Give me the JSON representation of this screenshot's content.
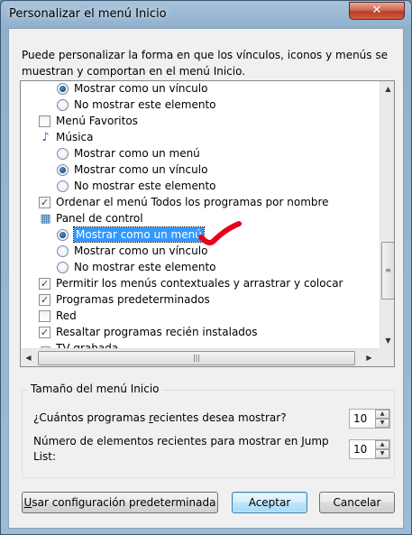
{
  "window": {
    "title": "Personalizar el menú Inicio",
    "close_label": "✕"
  },
  "intro_text": "Puede personalizar la forma en que los vínculos, iconos y menús se muestran y comportan en el menú Inicio.",
  "list_items": [
    {
      "kind": "radio",
      "checked": true,
      "label": "Mostrar como un vínculo"
    },
    {
      "kind": "radio",
      "checked": false,
      "label": "No mostrar este elemento"
    },
    {
      "kind": "check",
      "checked": false,
      "label": "Menú Favoritos"
    },
    {
      "kind": "header",
      "icon": "music-note-icon",
      "label": "Música"
    },
    {
      "kind": "radio",
      "checked": false,
      "label": "Mostrar como un menú"
    },
    {
      "kind": "radio",
      "checked": true,
      "label": "Mostrar como un vínculo"
    },
    {
      "kind": "radio",
      "checked": false,
      "label": "No mostrar este elemento"
    },
    {
      "kind": "check",
      "checked": true,
      "label": "Ordenar el menú Todos los programas por nombre"
    },
    {
      "kind": "header",
      "icon": "control-panel-icon",
      "label": "Panel de control"
    },
    {
      "kind": "radio",
      "checked": true,
      "label": "Mostrar como un menú",
      "selected": true
    },
    {
      "kind": "radio",
      "checked": false,
      "label": "Mostrar como un vínculo"
    },
    {
      "kind": "radio",
      "checked": false,
      "label": "No mostrar este elemento"
    },
    {
      "kind": "check",
      "checked": true,
      "label": "Permitir los menús contextuales y arrastrar y colocar"
    },
    {
      "kind": "check",
      "checked": true,
      "label": "Programas predeterminados"
    },
    {
      "kind": "check",
      "checked": false,
      "label": "Red"
    },
    {
      "kind": "check",
      "checked": true,
      "label": "Resaltar programas recién instalados"
    },
    {
      "kind": "header",
      "icon": "tv-icon",
      "label": "TV grabada"
    }
  ],
  "size_group": {
    "title": "Tamaño del menú Inicio",
    "recent_programs": {
      "label_pre": "¿Cuántos programas ",
      "label_access": "r",
      "label_post": "ecientes desea mostrar?",
      "value": "10"
    },
    "jump_list": {
      "label_pre": "Número de elementos recientes para mostrar en ",
      "label_access": "J",
      "label_post": "ump List:",
      "value": "10"
    }
  },
  "buttons": {
    "defaults_access": "U",
    "defaults_rest": "sar configuración predeterminada",
    "ok": "Aceptar",
    "cancel": "Cancelar"
  },
  "colors": {
    "selection": "#3399ff",
    "annotation_check": "#e8001c"
  }
}
